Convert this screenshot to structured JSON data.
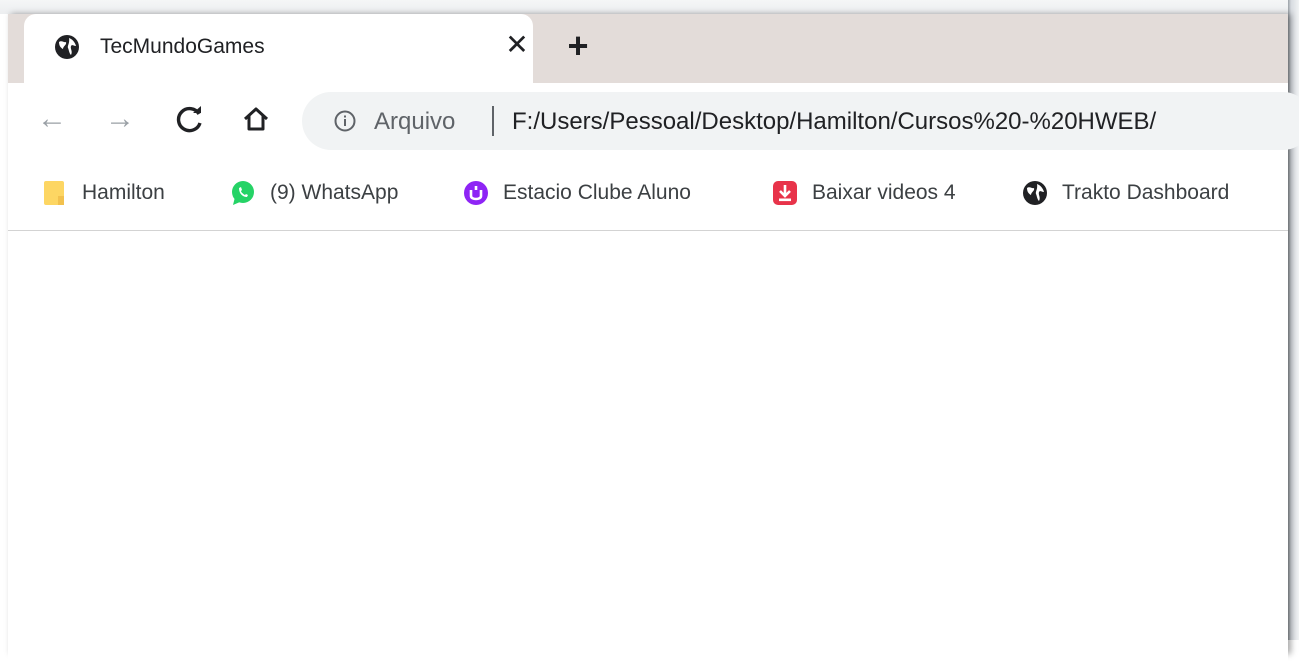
{
  "tab": {
    "title": "TecMundoGames",
    "icon": "globe-icon",
    "close_glyph": "✕"
  },
  "new_tab_glyph": "+",
  "toolbar": {
    "back_glyph": "←",
    "forward_glyph": "→",
    "reload_glyph": "C",
    "home_glyph": "⌂"
  },
  "omnibox": {
    "security_label": "Arquivo",
    "url": "F:/Users/Pessoal/Desktop/Hamilton/Cursos%20-%20HWEB/"
  },
  "bookmarks": [
    {
      "label": "Hamilton",
      "icon": "folder-icon",
      "color": "#fdd663"
    },
    {
      "label": "(9) WhatsApp",
      "icon": "whatsapp-icon",
      "color": "#25d366"
    },
    {
      "label": "Estacio Clube Aluno",
      "icon": "estacio-icon",
      "color": "#8e24f5"
    },
    {
      "label": "Baixar videos 4",
      "icon": "download-icon",
      "color": "#e8334a"
    },
    {
      "label": "Trakto Dashboard",
      "icon": "globe-icon",
      "color": "#202124"
    }
  ]
}
